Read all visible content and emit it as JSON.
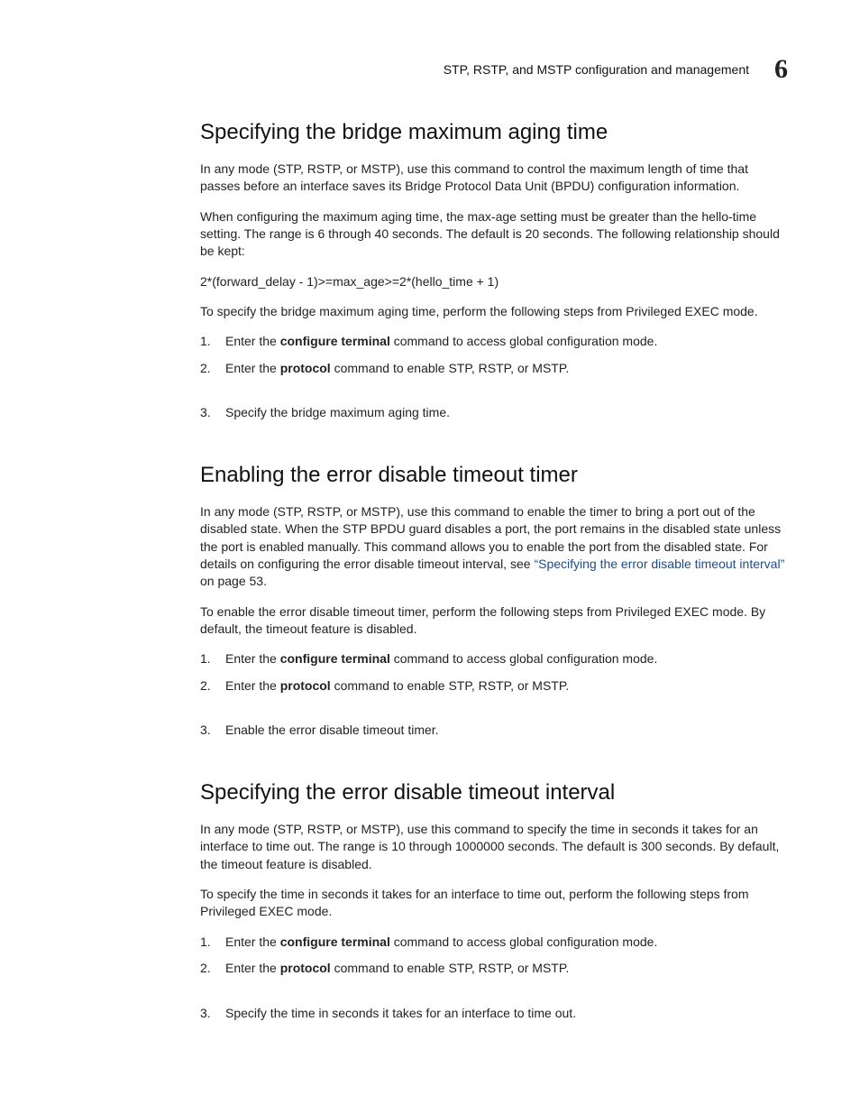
{
  "header": {
    "running_title": "STP, RSTP, and MSTP configuration and management",
    "chapter_number": "6"
  },
  "sections": [
    {
      "title": "Specifying the bridge maximum aging time",
      "paragraphs": [
        "In any mode (STP, RSTP, or MSTP), use this command to control the maximum length of time that passes before an interface saves its Bridge Protocol Data Unit (BPDU) configuration information.",
        "When configuring the maximum aging time, the max-age setting must be greater than the hello-time setting. The range is 6 through 40 seconds. The default is 20 seconds. The following relationship should be kept:",
        "2*(forward_delay - 1)>=max_age>=2*(hello_time + 1)",
        "To specify the bridge maximum aging time, perform the following steps from Privileged EXEC mode."
      ],
      "steps": [
        {
          "pre": "Enter the ",
          "bold": "configure terminal",
          "post": " command to access global configuration mode."
        },
        {
          "pre": "Enter the ",
          "bold": "protocol",
          "post": " command to enable STP, RSTP, or MSTP."
        },
        {
          "gap": true,
          "pre": "Specify the bridge maximum aging time.",
          "bold": "",
          "post": ""
        }
      ]
    },
    {
      "title": "Enabling the error disable timeout timer",
      "paragraphs_rich": [
        {
          "pre": "In any mode (STP, RSTP, or MSTP), use this command to enable the timer to bring a port out of the disabled state. When the STP BPDU guard disables a port, the port remains in the disabled state unless the port is enabled manually. This command allows you to enable the port from the disabled state. For details on configuring the error disable timeout interval, see ",
          "link": "“Specifying the error disable timeout interval”",
          "post": " on page 53."
        },
        {
          "pre": "To enable the error disable timeout timer, perform the following steps from Privileged EXEC mode. By default, the timeout feature is disabled.",
          "link": "",
          "post": ""
        }
      ],
      "steps": [
        {
          "pre": "Enter the ",
          "bold": "configure terminal",
          "post": " command to access global configuration mode."
        },
        {
          "pre": "Enter the ",
          "bold": "protocol",
          "post": " command to enable STP, RSTP, or MSTP."
        },
        {
          "gap": true,
          "pre": "Enable the error disable timeout timer.",
          "bold": "",
          "post": ""
        }
      ]
    },
    {
      "title": "Specifying the error disable timeout interval",
      "paragraphs": [
        "In any mode (STP, RSTP, or MSTP), use this command to specify the time in seconds it takes for an interface to time out. The range is 10 through 1000000 seconds. The default is 300 seconds. By default, the timeout feature is disabled.",
        "To specify the time in seconds it takes for an interface to time out, perform the following steps from Privileged EXEC mode."
      ],
      "steps": [
        {
          "pre": "Enter the ",
          "bold": "configure terminal",
          "post": " command to access global configuration mode."
        },
        {
          "pre": "Enter the ",
          "bold": "protocol",
          "post": " command to enable STP, RSTP, or MSTP."
        },
        {
          "gap": true,
          "pre": "Specify the time in seconds it takes for an interface to time out.",
          "bold": "",
          "post": ""
        }
      ]
    }
  ]
}
